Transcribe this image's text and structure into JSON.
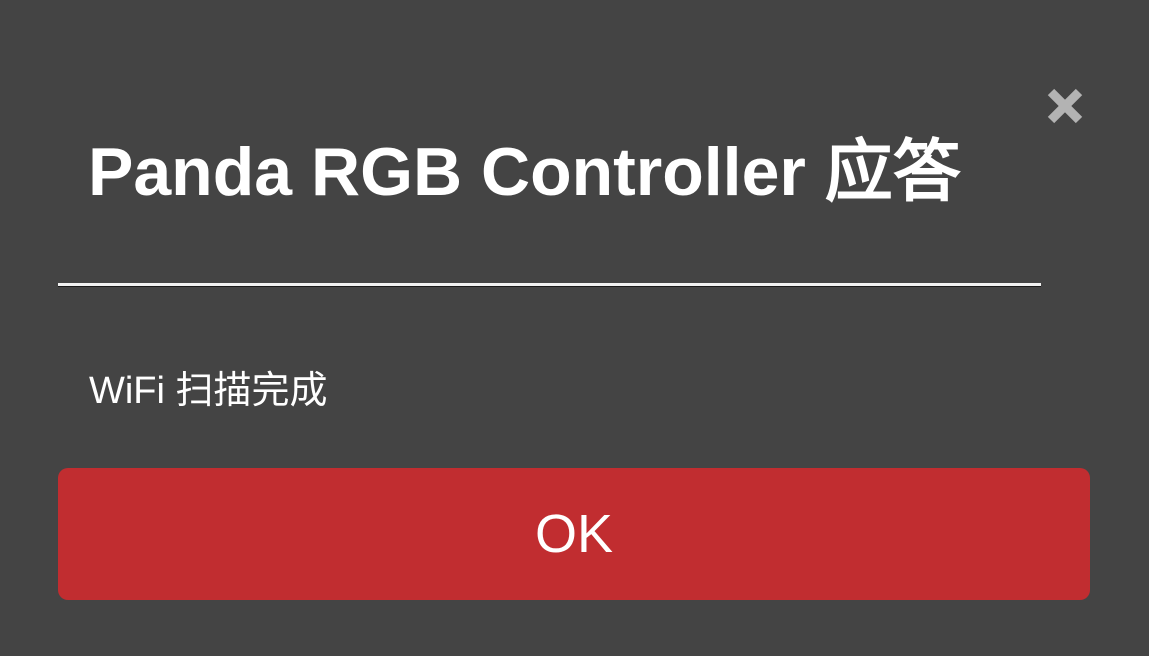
{
  "dialog": {
    "title": "Panda RGB Controller 应答",
    "message": "WiFi 扫描完成",
    "ok_label": "OK",
    "close_icon": "close-icon"
  },
  "colors": {
    "background": "#444444",
    "ok_button": "#c12d30",
    "close_icon": "#b3b3b3",
    "text": "#ffffff"
  }
}
